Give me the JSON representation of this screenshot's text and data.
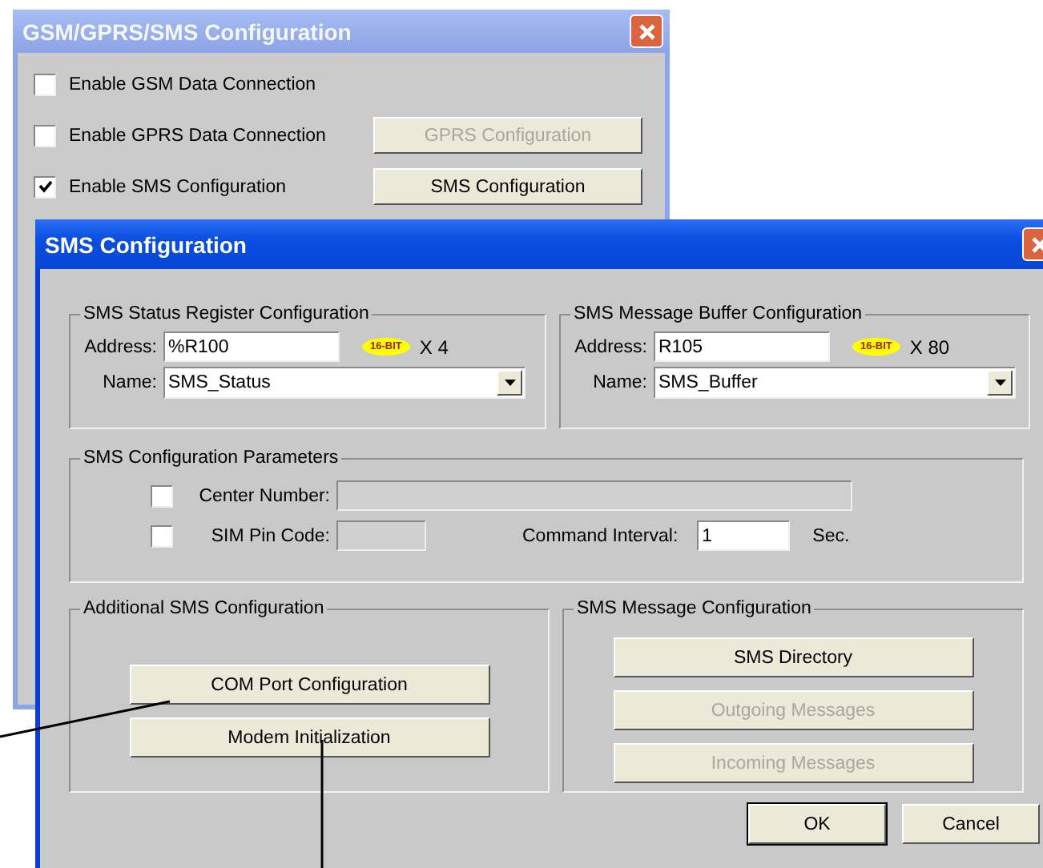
{
  "back_window": {
    "title": "GSM/GPRS/SMS Configuration",
    "options": [
      {
        "label": "Enable GSM Data Connection",
        "checked": false
      },
      {
        "label": "Enable GPRS Data Connection",
        "checked": false,
        "button": {
          "label": "GPRS Configuration",
          "disabled": true
        }
      },
      {
        "label": "Enable SMS Configuration",
        "checked": true,
        "button": {
          "label": "SMS Configuration",
          "disabled": false
        }
      }
    ]
  },
  "dialog": {
    "title": "SMS Configuration",
    "registers": [
      {
        "title": "SMS Status Register Configuration",
        "address_label": "Address:",
        "address": "%R100",
        "badge": "16-BIT",
        "multiplier": "X 4",
        "name_label": "Name:",
        "name": "SMS_Status"
      },
      {
        "title": "SMS Message Buffer Configuration",
        "address_label": "Address:",
        "address": "R105",
        "badge": "16-BIT",
        "multiplier": "X 80",
        "name_label": "Name:",
        "name": "SMS_Buffer"
      }
    ],
    "parameters": {
      "title": "SMS Configuration Parameters",
      "center_number": {
        "label": "Center Number:",
        "checked": false
      },
      "sim_pin": {
        "label": "SIM Pin Code:",
        "checked": false
      },
      "command_interval": {
        "label": "Command Interval:",
        "value": "1",
        "unit": "Sec."
      }
    },
    "groups": [
      {
        "title": "Additional SMS Configuration",
        "buttons": [
          {
            "label": "COM Port Configuration",
            "disabled": false
          },
          {
            "label": "Modem Initialization",
            "disabled": false
          }
        ]
      },
      {
        "title": "SMS Message Configuration",
        "buttons": [
          {
            "label": "SMS Directory",
            "disabled": false
          },
          {
            "label": "Outgoing Messages",
            "disabled": true
          },
          {
            "label": "Incoming Messages",
            "disabled": true
          }
        ]
      }
    ],
    "buttons": [
      {
        "label": "OK",
        "default": true
      },
      {
        "label": "Cancel",
        "default": false
      }
    ]
  }
}
